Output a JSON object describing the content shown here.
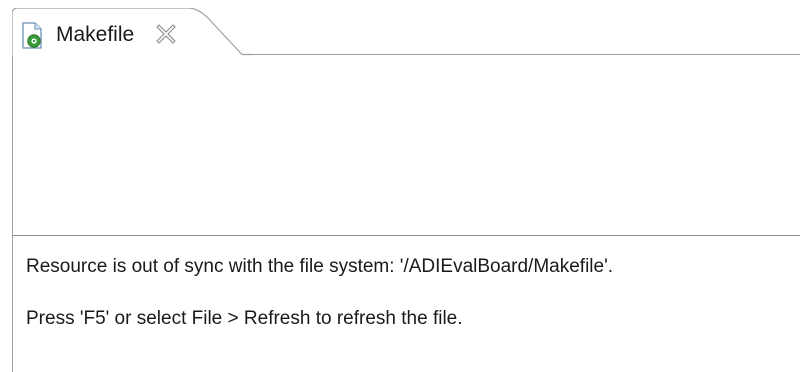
{
  "tab": {
    "label": "Makefile",
    "icon": "makefile-icon",
    "close_icon": "close-icon"
  },
  "editor": {
    "error_message": "Resource is out of sync with the file system: '/ADIEvalBoard/Makefile'.",
    "hint_message": "Press 'F5' or select File > Refresh to refresh the file."
  },
  "colors": {
    "border": "#a0a0a0",
    "icon_green": "#3a9a3a",
    "icon_blue": "#4a90d9"
  }
}
